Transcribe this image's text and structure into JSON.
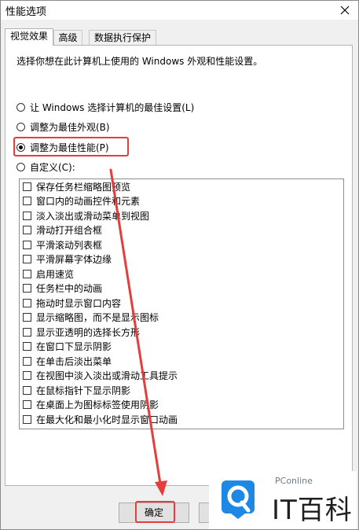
{
  "window": {
    "title": "性能选项",
    "close_icon": "close-icon"
  },
  "tabs": [
    {
      "label": "视觉效果",
      "active": true
    },
    {
      "label": "高级",
      "active": false
    },
    {
      "label": "数据执行保护",
      "active": false
    }
  ],
  "visual_effects": {
    "description": "选择你想在此计算机上使用的 Windows 外观和性能设置。",
    "options": [
      {
        "label": "让 Windows 选择计算机的最佳设置(L)",
        "checked": false
      },
      {
        "label": "调整为最佳外观(B)",
        "checked": false
      },
      {
        "label": "调整为最佳性能(P)",
        "checked": true
      },
      {
        "label": "自定义(C):",
        "checked": false
      }
    ],
    "effects": [
      {
        "label": "保存任务栏缩略图预览",
        "checked": false
      },
      {
        "label": "窗口内的动画控件和元素",
        "checked": false
      },
      {
        "label": "淡入淡出或滑动菜单到视图",
        "checked": false
      },
      {
        "label": "滑动打开组合框",
        "checked": false
      },
      {
        "label": "平滑滚动列表框",
        "checked": false
      },
      {
        "label": "平滑屏幕字体边缘",
        "checked": false
      },
      {
        "label": "启用速览",
        "checked": false
      },
      {
        "label": "任务栏中的动画",
        "checked": false
      },
      {
        "label": "拖动时显示窗口内容",
        "checked": false
      },
      {
        "label": "显示缩略图，而不是显示图标",
        "checked": false
      },
      {
        "label": "显示亚透明的选择长方形",
        "checked": false
      },
      {
        "label": "在窗口下显示阴影",
        "checked": false
      },
      {
        "label": "在单击后淡出菜单",
        "checked": false
      },
      {
        "label": "在视图中淡入淡出或滑动工具提示",
        "checked": false
      },
      {
        "label": "在鼠标指针下显示阴影",
        "checked": false
      },
      {
        "label": "在桌面上为图标标签使用阴影",
        "checked": false
      },
      {
        "label": "在最大化和最小化时显示窗口动画",
        "checked": false
      }
    ]
  },
  "buttons": {
    "ok_label": "确定"
  },
  "annotation": {
    "color": "#e53d3d"
  },
  "watermark": {
    "brand_small": "PConline",
    "brand_big": "IT百科",
    "logo_color": "#1e88e5"
  }
}
